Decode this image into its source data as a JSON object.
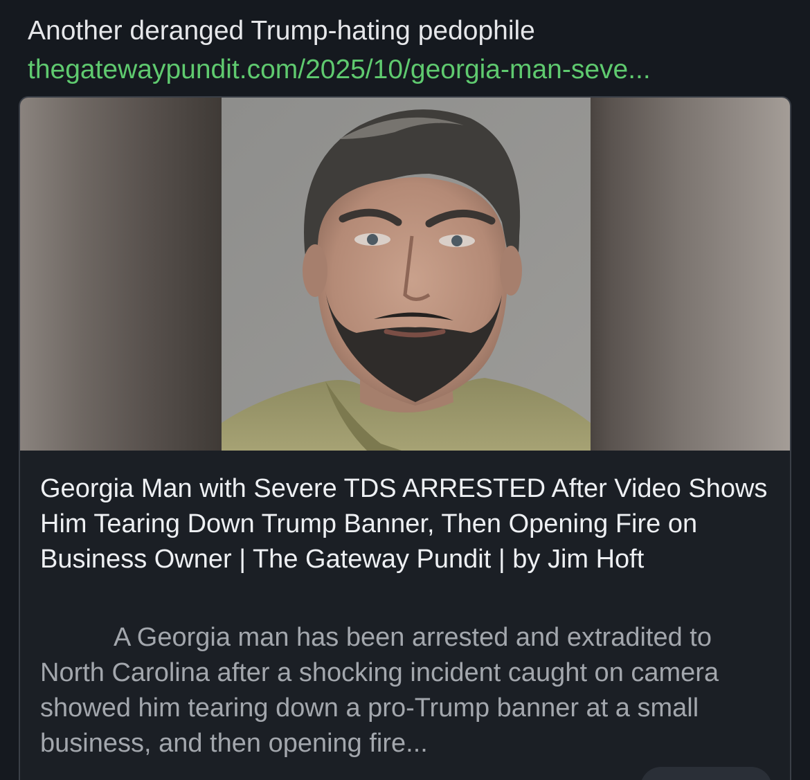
{
  "post": {
    "text": "Another deranged Trump-hating pedophile",
    "link": "thegatewaypundit.com/2025/10/georgia-man-seve..."
  },
  "card": {
    "image_alt": "mugshot-photo",
    "title": "Georgia Man with Severe TDS ARRESTED After Video Shows Him Tearing Down Trump Banner, Then Opening Fire on Business Owner | The Gateway Pundit | by Jim Hoft",
    "description": "A Georgia man has been arrested and extradited to North Carolina after a shocking incident caught on camera showed him tearing down a pro-Trump banner at a small business, and then opening fire..."
  },
  "colors": {
    "background": "#15191f",
    "link": "#5fca6f",
    "title": "#eef0f3",
    "description": "#a3a7ad"
  }
}
